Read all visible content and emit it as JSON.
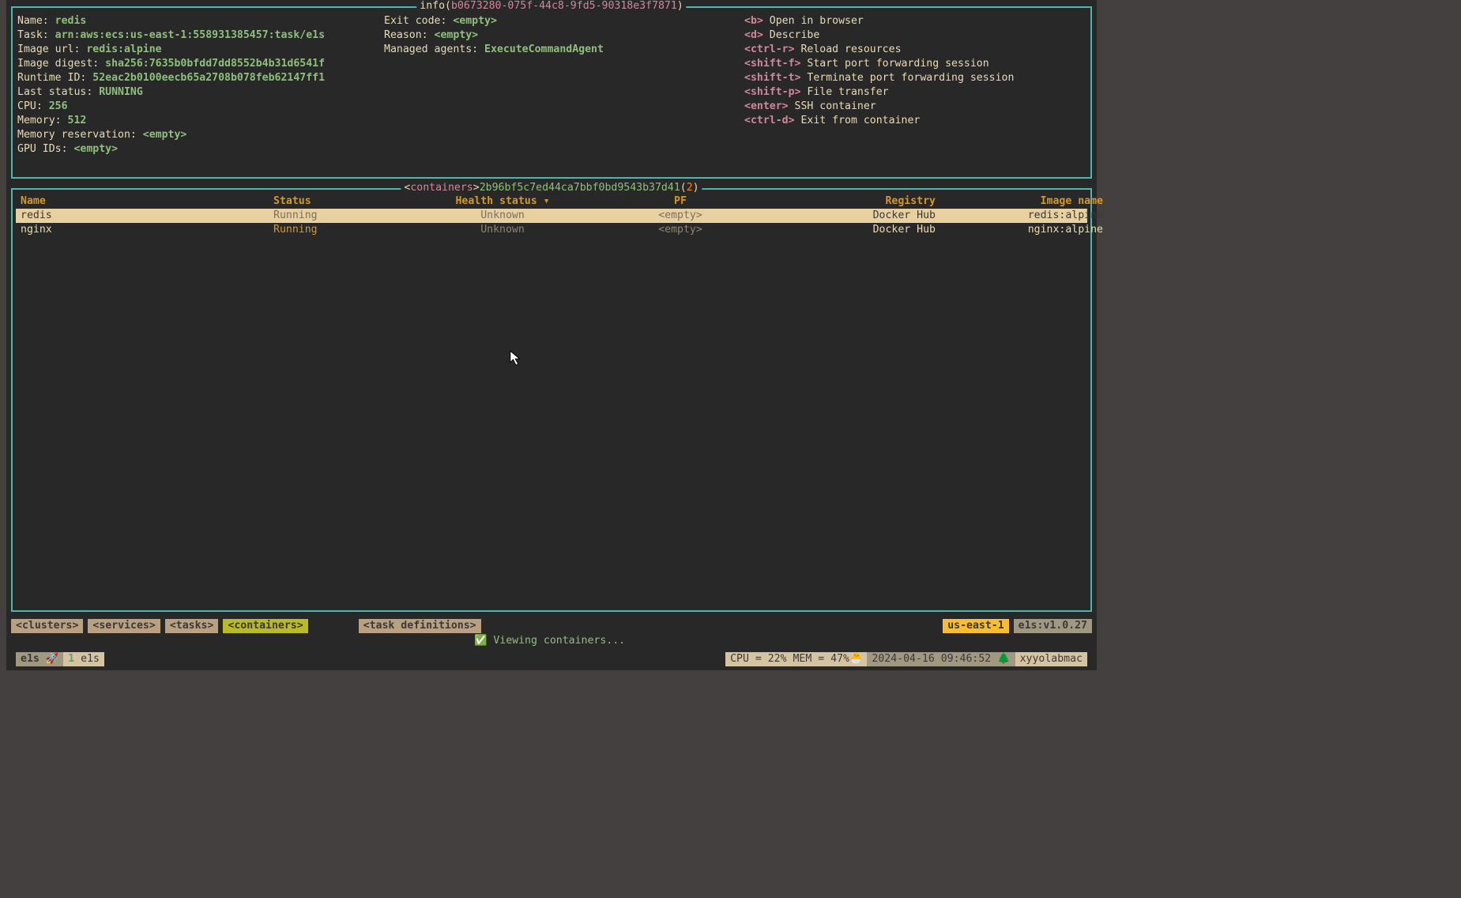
{
  "info": {
    "title_prefix": "info(",
    "title_id": "b0673280-075f-44c8-9fd5-90318e3f7871",
    "title_suffix": ")",
    "left": [
      {
        "k": "Name: ",
        "v": "redis"
      },
      {
        "k": "Task: ",
        "v": "arn:aws:ecs:us-east-1:558931385457:task/e1s"
      },
      {
        "k": "Image url: ",
        "v": "redis:alpine"
      },
      {
        "k": "Image digest: ",
        "v": "sha256:7635b0bfdd7dd8552b4b31d6541f"
      },
      {
        "k": "Runtime ID: ",
        "v": "52eac2b0100eecb65a2708b078feb62147ff1"
      },
      {
        "k": "Last status: ",
        "v": "RUNNING"
      },
      {
        "k": "CPU: ",
        "v": "256"
      },
      {
        "k": "Memory: ",
        "v": "512"
      },
      {
        "k": "Memory reservation: ",
        "v": "<empty>"
      },
      {
        "k": "GPU IDs: ",
        "v": "<empty>"
      }
    ],
    "middle": [
      {
        "k": "Exit code: ",
        "v": "<empty>"
      },
      {
        "k": "Reason: ",
        "v": "<empty>"
      },
      {
        "k": "Managed agents: ",
        "v": "ExecuteCommandAgent"
      }
    ],
    "shortcuts": [
      {
        "key": "<b>",
        "desc": " Open in browser"
      },
      {
        "key": "<d>",
        "desc": " Describe"
      },
      {
        "key": "<ctrl-r>",
        "desc": " Reload resources"
      },
      {
        "key": "<shift-f>",
        "desc": " Start port forwarding session"
      },
      {
        "key": "<shift-t>",
        "desc": " Terminate port forwarding session"
      },
      {
        "key": "<shift-p>",
        "desc": " File transfer"
      },
      {
        "key": "<enter>",
        "desc": " SSH container"
      },
      {
        "key": "<ctrl-d>",
        "desc": " Exit from container"
      }
    ]
  },
  "list": {
    "title_open": "<",
    "title_key": "containers",
    "title_close": ">",
    "title_hash": "2b96bf5c7ed44ca7bbf0bd9543b37d41",
    "title_paren_open": "(",
    "title_count": "2",
    "title_paren_close": ")",
    "headers": {
      "name": "Name",
      "status": "Status",
      "health": "Health status ▾",
      "pf": "PF",
      "registry": "Registry",
      "image": "Image name"
    },
    "rows": [
      {
        "name": "redis",
        "status": "Running",
        "health": "Unknown",
        "pf": "<empty>",
        "registry": "Docker Hub",
        "image": "redis:alpine",
        "selected": true
      },
      {
        "name": "nginx",
        "status": "Running",
        "health": "Unknown",
        "pf": "<empty>",
        "registry": "Docker Hub",
        "image": "nginx:alpine",
        "selected": false
      }
    ]
  },
  "tabs": {
    "items": [
      {
        "label": "<clusters>",
        "active": false
      },
      {
        "label": "<services>",
        "active": false
      },
      {
        "label": "<tasks>",
        "active": false
      },
      {
        "label": "<containers>",
        "active": true
      },
      {
        "label": "<task definitions>",
        "active": false,
        "gap": true
      }
    ],
    "region": "us-east-1",
    "version": "e1s:v1.0.27"
  },
  "help_line": {
    "check": "✅",
    "text": " Viewing containers..."
  },
  "status": {
    "app": "e1s 🚀",
    "ctx_num": "1",
    "ctx_txt": " e1s",
    "sys": "CPU = 22% MEM = 47%🐣",
    "time": "2024-04-16 09:46:52 🌲",
    "host": "xyyolabmac"
  }
}
